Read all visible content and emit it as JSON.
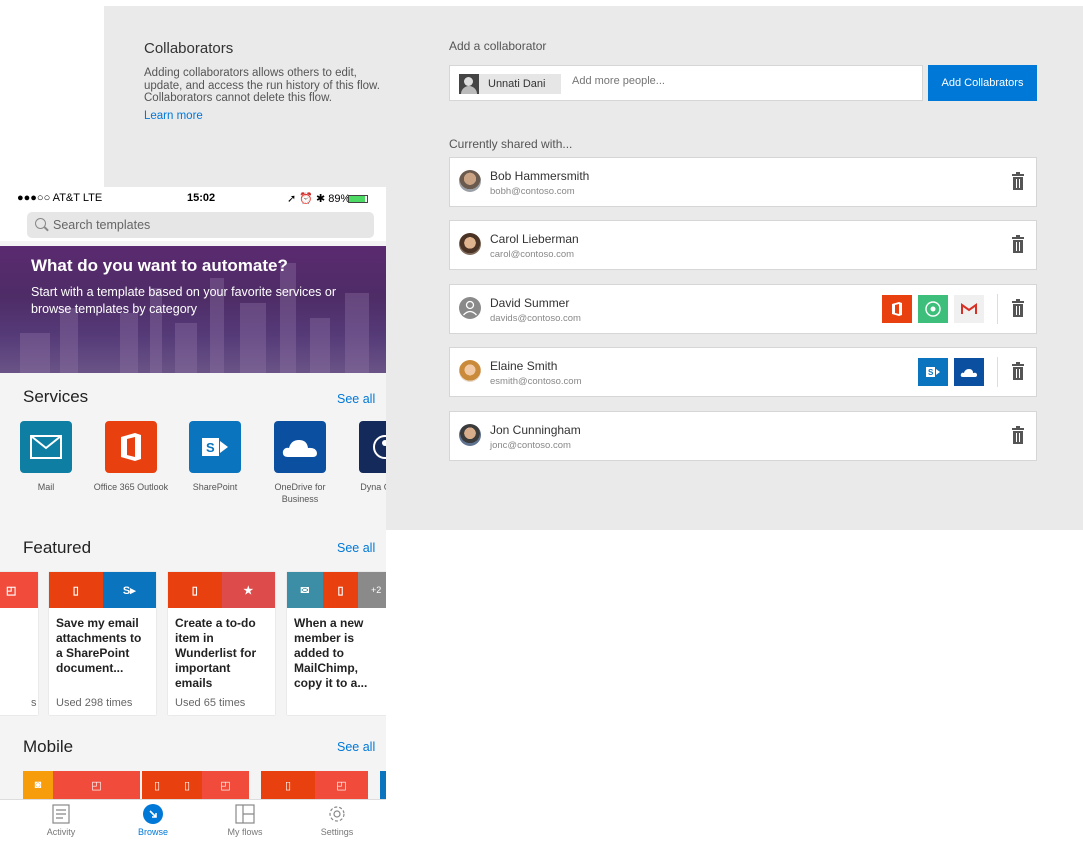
{
  "collab": {
    "title": "Collaborators",
    "description": "Adding collaborators allows others to edit, update, and access the run history of this flow. Collaborators cannot delete this flow.",
    "learn_more": "Learn more",
    "add_label": "Add a collaborator",
    "chip_name": "Unnati Dani",
    "input_placeholder": "Add more people...",
    "add_button": "Add Collabrators",
    "shared_label": "Currently shared with...",
    "people": [
      {
        "name": "Bob Hammersmith",
        "email": "bobh@contoso.com",
        "avatar": "photo",
        "services": []
      },
      {
        "name": "Carol Lieberman",
        "email": "carol@contoso.com",
        "avatar": "photo",
        "services": []
      },
      {
        "name": "David Summer",
        "email": "davids@contoso.com",
        "avatar": "generic",
        "services": [
          "office365",
          "wunderlist",
          "gmail"
        ]
      },
      {
        "name": "Elaine Smith",
        "email": "esmith@contoso.com",
        "avatar": "photo",
        "services": [
          "sharepoint",
          "onedrive"
        ]
      },
      {
        "name": "Jon Cunningham",
        "email": "jonc@contoso.com",
        "avatar": "photo",
        "services": []
      }
    ]
  },
  "phone": {
    "status": {
      "carrier": "●●●○○ AT&T  LTE",
      "time": "15:02",
      "right": "➚ ⏰ ✱ 89%"
    },
    "search_placeholder": "Search templates",
    "hero": {
      "title": "What do you want to automate?",
      "subtitle": "Start with a template based on your favorite services or browse templates by category"
    },
    "services": {
      "title": "Services",
      "see_all": "See all",
      "items": [
        {
          "label": "Mail",
          "color": "#0e7fa3",
          "icon": "mail-icon"
        },
        {
          "label": "Office 365 Outlook",
          "color": "#e8400f",
          "icon": "office-icon"
        },
        {
          "label": "SharePoint",
          "color": "#0a74be",
          "icon": "sharepoint-icon"
        },
        {
          "label": "OneDrive for Business",
          "color": "#0b4fa1",
          "icon": "onedrive-icon"
        },
        {
          "label": "Dyna CRM (",
          "color": "#142a5a",
          "icon": "dynamics-icon"
        }
      ]
    },
    "featured": {
      "title": "Featured",
      "see_all": "See all",
      "partial_uses": "s",
      "cards": [
        {
          "title": "Save my email attachments to a SharePoint document...",
          "uses": "Used 298 times"
        },
        {
          "title": "Create a to-do item in Wunderlist for important emails",
          "uses": "Used 65 times"
        },
        {
          "title": "When a new member is added to MailChimp, copy it to a...",
          "uses": "",
          "extra": "+2"
        }
      ]
    },
    "mobile": {
      "title": "Mobile",
      "see_all": "See all"
    },
    "tabs": [
      {
        "label": "Activity",
        "icon": "activity-icon",
        "active": false
      },
      {
        "label": "Browse",
        "icon": "browse-icon",
        "active": true
      },
      {
        "label": "My flows",
        "icon": "flows-icon",
        "active": false
      },
      {
        "label": "Settings",
        "icon": "settings-icon",
        "active": false
      }
    ]
  }
}
